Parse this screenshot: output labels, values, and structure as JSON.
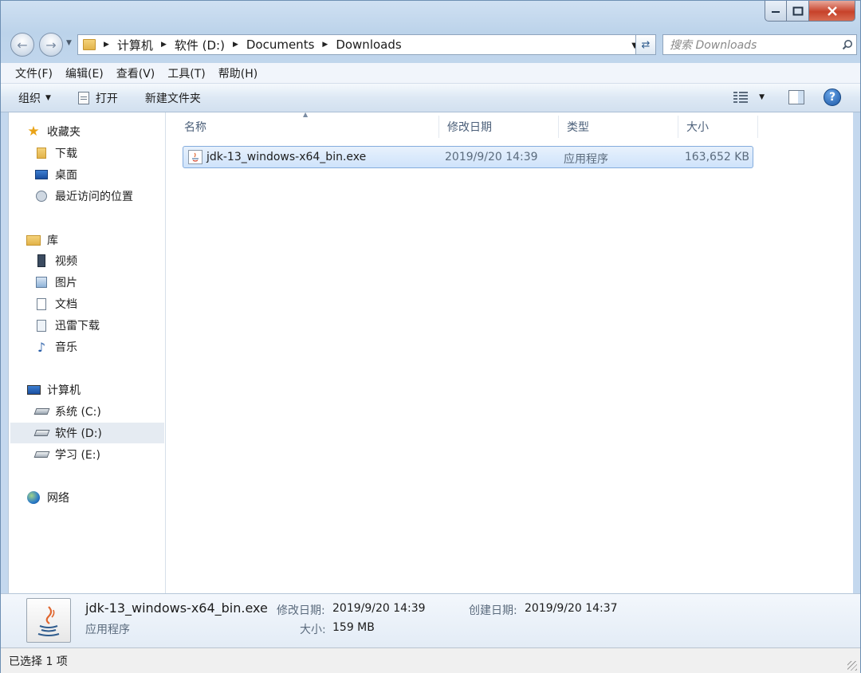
{
  "nav": {
    "address": [
      "计算机",
      "软件 (D:)",
      "Documents",
      "Downloads"
    ],
    "search_placeholder": "搜索 Downloads"
  },
  "menu": [
    "文件(F)",
    "编辑(E)",
    "查看(V)",
    "工具(T)",
    "帮助(H)"
  ],
  "toolbar": {
    "organize": "组织",
    "open": "打开",
    "new_folder": "新建文件夹"
  },
  "sidebar": {
    "favorites": {
      "label": "收藏夹",
      "items": [
        "下载",
        "桌面",
        "最近访问的位置"
      ]
    },
    "libraries": {
      "label": "库",
      "items": [
        "视频",
        "图片",
        "文档",
        "迅雷下载",
        "音乐"
      ]
    },
    "computer": {
      "label": "计算机",
      "items": [
        "系统 (C:)",
        "软件 (D:)",
        "学习 (E:)"
      ]
    },
    "network": {
      "label": "网络"
    }
  },
  "columns": [
    "名称",
    "修改日期",
    "类型",
    "大小"
  ],
  "files": [
    {
      "name": "jdk-13_windows-x64_bin.exe",
      "modified": "2019/9/20 14:39",
      "type": "应用程序",
      "size": "163,652 KB"
    }
  ],
  "details": {
    "name": "jdk-13_windows-x64_bin.exe",
    "type": "应用程序",
    "modified_label": "修改日期:",
    "modified": "2019/9/20 14:39",
    "created_label": "创建日期:",
    "created": "2019/9/20 14:37",
    "size_label": "大小:",
    "size": "159 MB"
  },
  "status": "已选择 1 项",
  "colors": {
    "selection": "#cfe3fb",
    "selection_border": "#84acdd",
    "toolbar": "#dde8f4",
    "accent": "#1b57a6"
  },
  "icons": [
    "back-arrow-icon",
    "forward-arrow-icon",
    "folder-icon",
    "refresh-icon",
    "search-icon",
    "help-icon",
    "star-icon",
    "java-icon"
  ]
}
